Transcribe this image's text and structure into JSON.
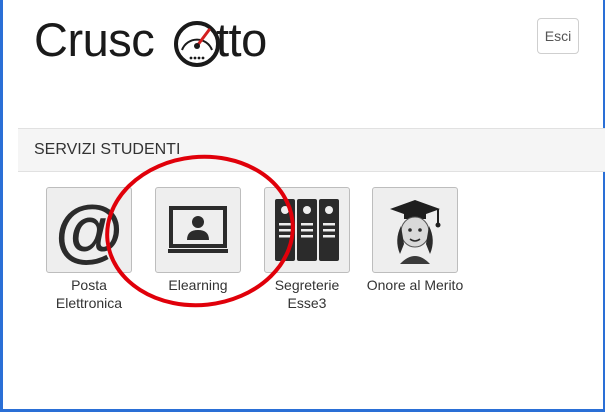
{
  "header": {
    "logo_text_left": "Crusc",
    "logo_text_right": "tto",
    "logout_label": "Esci"
  },
  "section": {
    "title": "SERVIZI STUDENTI"
  },
  "services": [
    {
      "label_line1": "Posta",
      "label_line2": "Elettronica",
      "icon": "at-sign-icon"
    },
    {
      "label_line1": "Elearning",
      "label_line2": "",
      "icon": "monitor-user-icon"
    },
    {
      "label_line1": "Segreterie",
      "label_line2": "Esse3",
      "icon": "binders-icon"
    },
    {
      "label_line1": "Onore al Merito",
      "label_line2": "",
      "icon": "graduate-icon"
    }
  ],
  "colors": {
    "frame": "#2a6fd6",
    "annotation": "#e0000a",
    "logo_gauge_red": "#d42020",
    "icon_dark": "#2b2b2b"
  }
}
